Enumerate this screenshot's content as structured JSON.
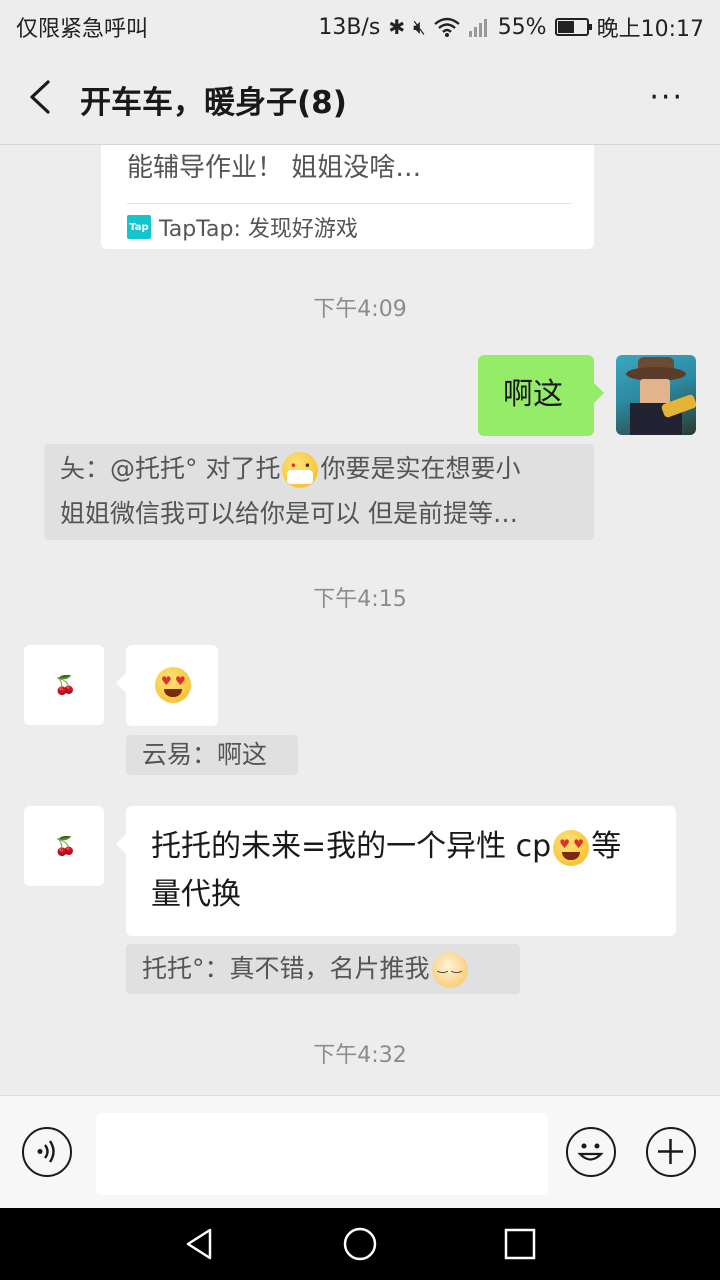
{
  "status_bar": {
    "carrier": "仅限紧急呼叫",
    "net_speed": "13B/s",
    "battery": "55%",
    "time": "晚上10:17"
  },
  "header": {
    "title": "开车车，暖身子(8)",
    "back_icon": "chevron-left-icon",
    "more_label": "···"
  },
  "messages": {
    "card": {
      "desc": "能辅导作业！ 姐姐没啥…",
      "source_logo": "Tap",
      "source": "TapTap: 发现好游戏"
    },
    "time1": "下午4:09",
    "my_msg": "啊这",
    "quote1_line1_a": "夨：@托托° 对了托",
    "quote1_line1_b": "你要是实在想要小",
    "quote1_line2": "姐姐微信我可以给你是可以 但是前提等…",
    "time2": "下午4:15",
    "cherry_icon": "🍒",
    "quote2": "云易：啊这",
    "msg2_a": "托托的未来=我的一个异性 cp",
    "msg2_b": "等",
    "msg2_c": "量代换",
    "quote3": "托托°：真不错，名片推我",
    "time3": "下午4:32"
  },
  "input_bar": {
    "voice_icon": "voice-icon",
    "emoji_icon": "emoji-icon",
    "plus_icon": "plus-icon"
  },
  "colors": {
    "my_bubble": "#95ec69",
    "background": "#ededed"
  }
}
